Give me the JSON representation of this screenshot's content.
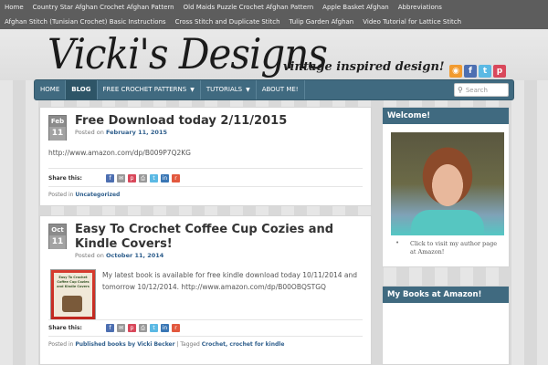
{
  "topnav": {
    "row1": [
      "Home",
      "Country Star Afghan Crochet Afghan Pattern",
      "Old Maids Puzzle Crochet Afghan Pattern",
      "Apple Basket Afghan",
      "Abbreviations"
    ],
    "row2": [
      "Afghan Stitch (Tunisian Crochet) Basic Instructions",
      "Cross Stitch and Duplicate Stitch",
      "Tulip Garden Afghan",
      "Video Tutorial for Lattice Stitch"
    ]
  },
  "header": {
    "logo": "Vicki's Designs",
    "tagline": "vintage inspired design!",
    "social": [
      {
        "icon": "rss-icon",
        "glyph": "◉",
        "color": "#f29b30"
      },
      {
        "icon": "facebook-icon",
        "glyph": "f",
        "color": "#4d6fb1"
      },
      {
        "icon": "twitter-icon",
        "glyph": "t",
        "color": "#5bb9e4"
      },
      {
        "icon": "pinterest-icon",
        "glyph": "p",
        "color": "#d9485b"
      }
    ]
  },
  "mainnav": {
    "items": [
      {
        "label": "HOME",
        "caret": false,
        "active": false
      },
      {
        "label": "BLOG",
        "caret": false,
        "active": true
      },
      {
        "label": "FREE CROCHET PATTERNS",
        "caret": true,
        "active": false
      },
      {
        "label": "TUTORIALS",
        "caret": true,
        "active": false
      },
      {
        "label": "ABOUT ME!",
        "caret": false,
        "active": false
      }
    ],
    "search_placeholder": "Search"
  },
  "posts": [
    {
      "month": "Feb",
      "day": "11",
      "title": "Free Download today 2/11/2015",
      "posted_prefix": "Posted on ",
      "posted_date": "February 11, 2015",
      "body": "http://www.amazon.com/dp/B009P7Q2KG",
      "share_label": "Share this:",
      "category_prefix": "Posted in ",
      "category": "Uncategorized"
    },
    {
      "month": "Oct",
      "day": "11",
      "title": "Easy To Crochet Coffee Cup Cozies and Kindle Covers!",
      "posted_prefix": "Posted on ",
      "posted_date": "October 11, 2014",
      "body": "My latest book is available for free kindle download today 10/11/2014 and tomorrow 10/12/2014. http://www.amazon.com/dp/B00OBQSTGQ",
      "thumb_text": "Easy To Crochet Coffee Cup Cozies and Kindle Covers",
      "share_label": "Share this:",
      "category_prefix": "Posted in ",
      "category": "Published books by Vicki Becker",
      "tagged_prefix": " | Tagged ",
      "tags": "Crochet, crochet for kindle"
    }
  ],
  "share_icons": [
    {
      "icon": "facebook-share-icon",
      "color": "#4d6fb1",
      "glyph": "f"
    },
    {
      "icon": "email-share-icon",
      "color": "#999999",
      "glyph": "✉"
    },
    {
      "icon": "pinterest-share-icon",
      "color": "#d9485b",
      "glyph": "p"
    },
    {
      "icon": "print-share-icon",
      "color": "#999999",
      "glyph": "⎙"
    },
    {
      "icon": "twitter-share-icon",
      "color": "#5bb9e4",
      "glyph": "t"
    },
    {
      "icon": "linkedin-share-icon",
      "color": "#3a77b5",
      "glyph": "in"
    },
    {
      "icon": "reddit-share-icon",
      "color": "#e2583e",
      "glyph": "r"
    }
  ],
  "sidebar": {
    "welcome_title": "Welcome!",
    "photo_caption": "Click to visit my author page at Amazon!",
    "books_title": "My Books at Amazon!"
  }
}
